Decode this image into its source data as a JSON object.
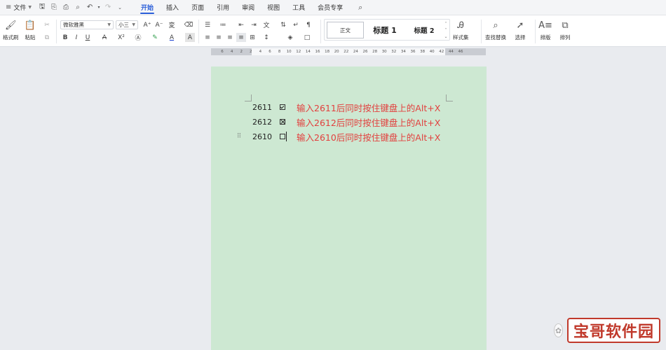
{
  "menu": {
    "file_label": "文件",
    "tabs": [
      {
        "label": "开始",
        "active": true
      },
      {
        "label": "插入"
      },
      {
        "label": "页面"
      },
      {
        "label": "引用"
      },
      {
        "label": "审阅"
      },
      {
        "label": "视图"
      },
      {
        "label": "工具"
      },
      {
        "label": "会员专享"
      }
    ]
  },
  "ribbon": {
    "format_painter": "格式刷",
    "paste": "粘贴",
    "font_name": "微软雅黑",
    "font_size": "小三",
    "style_normal": "正文",
    "style_h1": "标题 1",
    "style_h2": "标题 2",
    "styles_set": "样式集",
    "find_replace": "查找替换",
    "select": "选择",
    "layout": "排版",
    "arrange": "排列"
  },
  "ruler": {
    "labels": [
      "6",
      "4",
      "2",
      "2",
      "4",
      "6",
      "8",
      "10",
      "12",
      "14",
      "16",
      "18",
      "20",
      "22",
      "24",
      "26",
      "28",
      "30",
      "32",
      "34",
      "36",
      "38",
      "40",
      "42",
      "44",
      "46"
    ]
  },
  "document": {
    "lines": [
      {
        "code": "2611",
        "symbol": "check",
        "note": "输入2611后同时按住键盘上的Alt+X"
      },
      {
        "code": "2612",
        "symbol": "cross",
        "note": "输入2612后同时按住键盘上的Alt+X"
      },
      {
        "code": "2610",
        "symbol": "empty",
        "note": "输入2610后同时按住键盘上的Alt+X"
      }
    ]
  },
  "watermark": {
    "text": "宝哥软件园"
  }
}
